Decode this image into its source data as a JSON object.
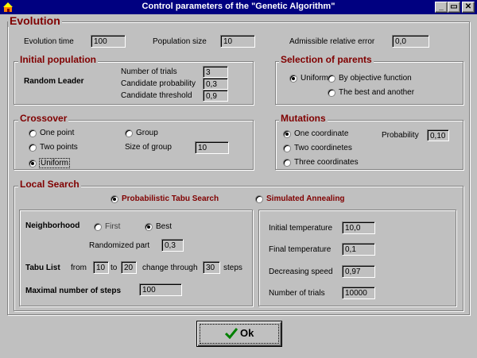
{
  "window": {
    "title": "Control parameters of the \"Genetic Algorithm\"",
    "min_label": "_",
    "max_label": "▭",
    "close_label": "✕"
  },
  "evolution": {
    "title": "Evolution",
    "evolution_time_label": "Evolution time",
    "evolution_time_value": "100",
    "population_size_label": "Population size",
    "population_size_value": "10",
    "admissible_error_label": "Admissible relative error",
    "admissible_error_value": "0,0"
  },
  "initial_population": {
    "title": "Initial population",
    "mode_label": "Random Leader",
    "number_of_trials_label": "Number of trials",
    "number_of_trials_value": "3",
    "candidate_probability_label": "Candidate probability",
    "candidate_probability_value": "0,3",
    "candidate_threshold_label": "Candidate threshold",
    "candidate_threshold_value": "0,9"
  },
  "selection": {
    "title": "Selection of parents",
    "options": [
      "Uniform",
      "By objective function",
      "The best and another"
    ],
    "selected": "Uniform"
  },
  "crossover": {
    "title": "Crossover",
    "options": [
      "One point",
      "Two points",
      "Uniform",
      "Group"
    ],
    "selected": "Uniform",
    "size_of_group_label": "Size of group",
    "size_of_group_value": "10"
  },
  "mutations": {
    "title": "Mutations",
    "options": [
      "One coordinate",
      "Two coordinetes",
      "Three coordinates"
    ],
    "selected": "One coordinate",
    "probability_label": "Probability",
    "probability_value": "0,10"
  },
  "local_search": {
    "title": "Local Search",
    "methods": [
      "Probabilistic Tabu Search",
      "Simulated Annealing"
    ],
    "selected_method": "Probabilistic Tabu Search",
    "tabu": {
      "neighborhood_label": "Neighborhood",
      "neighborhood_options": [
        "First",
        "Best"
      ],
      "neighborhood_selected": "Best",
      "randomized_part_label": "Randomized part",
      "randomized_part_value": "0,3",
      "tabu_list_label": "Tabu List",
      "from_label": "from",
      "from_value": "10",
      "to_label": "to",
      "to_value": "20",
      "change_through_label": "change through",
      "change_through_value": "30",
      "steps_label": "steps",
      "max_steps_label": "Maximal number of steps",
      "max_steps_value": "100"
    },
    "annealing": {
      "initial_temperature_label": "Initial temperature",
      "initial_temperature_value": "10,0",
      "final_temperature_label": "Final temperature",
      "final_temperature_value": "0,1",
      "decreasing_speed_label": "Decreasing speed",
      "decreasing_speed_value": "0,97",
      "number_of_trials_label": "Number of trials",
      "number_of_trials_value": "10000"
    }
  },
  "ok_button": {
    "label": "Ok"
  },
  "colors": {
    "title_bar": "#000080",
    "face": "#c0c0c0",
    "section_title": "#800000",
    "check_mark": "#008000"
  }
}
